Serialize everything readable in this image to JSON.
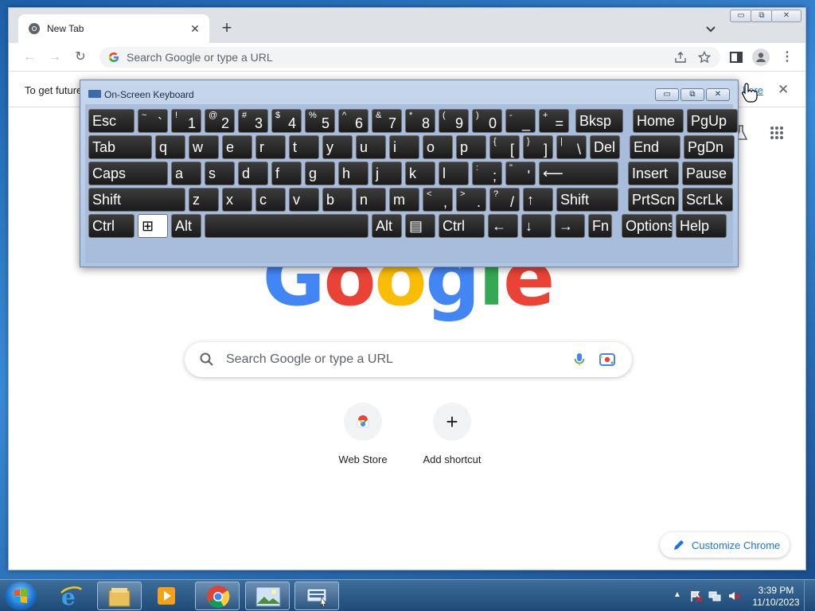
{
  "browser": {
    "tab_title": "New Tab",
    "tab_close": "✕",
    "new_tab": "+",
    "omnibox_placeholder": "Search Google or type a URL",
    "infobar_text": "To get future",
    "infobar_link": "hore",
    "infobar_close": "✕",
    "window_controls": {
      "minimize": "▭",
      "restore": "⧉",
      "close": "✕"
    }
  },
  "ntp": {
    "logo_letters": [
      "G",
      "o",
      "o",
      "g",
      "l",
      "e"
    ],
    "logo_colors": [
      "#4285f4",
      "#ea4335",
      "#fbbc05",
      "#4285f4",
      "#34a853",
      "#ea4335"
    ],
    "search_placeholder": "Search Google or type a URL",
    "shortcuts": [
      {
        "label": "Web Store",
        "icon": "web-store-icon"
      },
      {
        "label": "Add shortcut",
        "icon": "+"
      }
    ],
    "customize_label": "Customize Chrome"
  },
  "osk": {
    "title": "On-Screen Keyboard",
    "controls": {
      "minimize": "▭",
      "restore": "⧉",
      "close": "✕"
    },
    "rows": [
      [
        {
          "main": "Esc",
          "w": 58
        },
        {
          "top": "~",
          "low": "`",
          "w": 38
        },
        {
          "top": "!",
          "low": "1",
          "w": 38
        },
        {
          "top": "@",
          "low": "2",
          "w": 38
        },
        {
          "top": "#",
          "low": "3",
          "w": 38
        },
        {
          "top": "$",
          "low": "4",
          "w": 38
        },
        {
          "top": "%",
          "low": "5",
          "w": 38
        },
        {
          "top": "^",
          "low": "6",
          "w": 38
        },
        {
          "top": "&",
          "low": "7",
          "w": 38
        },
        {
          "top": "*",
          "low": "8",
          "w": 38
        },
        {
          "top": "(",
          "low": "9",
          "w": 38
        },
        {
          "top": ")",
          "low": "0",
          "w": 38
        },
        {
          "top": "-",
          "low": "_",
          "w": 38
        },
        {
          "top": "+",
          "low": "=",
          "w": 38
        },
        {
          "main": "Bksp",
          "w": 60,
          "gap": 4
        },
        {
          "main": "Home",
          "w": 64,
          "gap": 8
        },
        {
          "main": "PgUp",
          "w": 64
        }
      ],
      [
        {
          "main": "Tab",
          "w": 80
        },
        {
          "main": "q",
          "w": 38
        },
        {
          "main": "w",
          "w": 38
        },
        {
          "main": "e",
          "w": 38
        },
        {
          "main": "r",
          "w": 38
        },
        {
          "main": "t",
          "w": 38
        },
        {
          "main": "y",
          "w": 38
        },
        {
          "main": "u",
          "w": 38
        },
        {
          "main": "i",
          "w": 38
        },
        {
          "main": "o",
          "w": 38
        },
        {
          "main": "p",
          "w": 38
        },
        {
          "top": "{",
          "low": "[",
          "w": 38
        },
        {
          "top": "}",
          "low": "]",
          "w": 38
        },
        {
          "top": "|",
          "low": "\\",
          "w": 38
        },
        {
          "main": "Del",
          "w": 38
        },
        {
          "main": "End",
          "w": 64,
          "gap": 8
        },
        {
          "main": "PgDn",
          "w": 64
        }
      ],
      [
        {
          "main": "Caps",
          "w": 100
        },
        {
          "main": "a",
          "w": 38
        },
        {
          "main": "s",
          "w": 38
        },
        {
          "main": "d",
          "w": 38
        },
        {
          "main": "f",
          "w": 38
        },
        {
          "main": "g",
          "w": 38
        },
        {
          "main": "h",
          "w": 38
        },
        {
          "main": "j",
          "w": 38
        },
        {
          "main": "k",
          "w": 38
        },
        {
          "main": "l",
          "w": 38
        },
        {
          "top": ":",
          "low": ";",
          "w": 38
        },
        {
          "top": "\"",
          "low": "'",
          "w": 38
        },
        {
          "main": "⟵",
          "w": 100
        },
        {
          "main": "Insert",
          "w": 64,
          "gap": 8
        },
        {
          "main": "Pause",
          "w": 64
        }
      ],
      [
        {
          "main": "Shift",
          "w": 122
        },
        {
          "main": "z",
          "w": 38
        },
        {
          "main": "x",
          "w": 38
        },
        {
          "main": "c",
          "w": 38
        },
        {
          "main": "v",
          "w": 38
        },
        {
          "main": "b",
          "w": 38
        },
        {
          "main": "n",
          "w": 38
        },
        {
          "main": "m",
          "w": 38
        },
        {
          "top": "<",
          "low": ",",
          "w": 38
        },
        {
          "top": ">",
          "low": ".",
          "w": 38
        },
        {
          "top": "?",
          "low": "/",
          "w": 38
        },
        {
          "main": "↑",
          "w": 38
        },
        {
          "main": "Shift",
          "w": 78
        },
        {
          "main": "PrtScn",
          "w": 64,
          "gap": 8
        },
        {
          "main": "ScrLk",
          "w": 64
        }
      ],
      [
        {
          "main": "Ctrl",
          "w": 58
        },
        {
          "main": "⊞",
          "w": 38,
          "white": true
        },
        {
          "main": "Alt",
          "w": 38
        },
        {
          "main": "",
          "w": 206
        },
        {
          "main": "Alt",
          "w": 38
        },
        {
          "main": "▤",
          "w": 38
        },
        {
          "main": "Ctrl",
          "w": 58
        },
        {
          "main": "←",
          "w": 38
        },
        {
          "main": "↓",
          "w": 38
        },
        {
          "main": "→",
          "w": 38
        },
        {
          "main": "Fn",
          "w": 30
        },
        {
          "main": "Options",
          "w": 64,
          "gap": 8
        },
        {
          "main": "Help",
          "w": 64
        }
      ]
    ]
  },
  "taskbar": {
    "apps": [
      "internet-explorer-icon",
      "file-explorer-icon",
      "media-player-icon",
      "chrome-icon",
      "image-viewer-icon",
      "on-screen-keyboard-icon"
    ],
    "tray_arrow": "▲",
    "clock_time": "3:39 PM",
    "clock_date": "11/10/2023"
  }
}
